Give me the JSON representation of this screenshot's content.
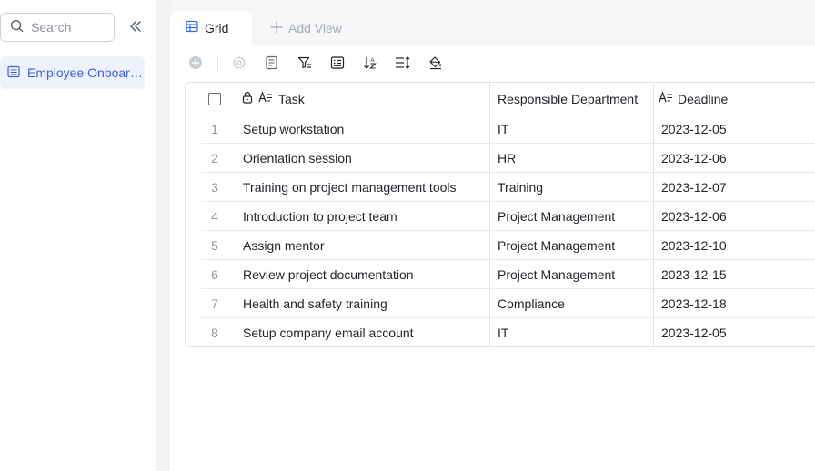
{
  "sidebar": {
    "search_placeholder": "Search",
    "collapse_icon": "double-chevron-left-icon",
    "table_item_label": "Employee Onboarding",
    "table_item_icon": "table-icon",
    "accent_color": "#3b63d9",
    "active_bg": "#eef2fd"
  },
  "tabs": {
    "active_label": "Grid",
    "add_view_label": "Add View"
  },
  "toolbar": {
    "icons": [
      "add-record-icon",
      "settings-icon",
      "field-icon",
      "filter-icon",
      "card-icon",
      "sort-icon",
      "row-height-icon",
      "paint-icon"
    ]
  },
  "grid": {
    "columns": {
      "task": "Task",
      "department": "Responsible Department",
      "deadline": "Deadline"
    },
    "rows": [
      {
        "num": "1",
        "task": "Setup workstation",
        "department": "IT",
        "deadline": "2023-12-05"
      },
      {
        "num": "2",
        "task": "Orientation session",
        "department": "HR",
        "deadline": "2023-12-06"
      },
      {
        "num": "3",
        "task": "Training on project management tools",
        "department": "Training",
        "deadline": "2023-12-07"
      },
      {
        "num": "4",
        "task": "Introduction to project team",
        "department": "Project Management",
        "deadline": "2023-12-06"
      },
      {
        "num": "5",
        "task": "Assign mentor",
        "department": "Project Management",
        "deadline": "2023-12-10"
      },
      {
        "num": "6",
        "task": "Review project documentation",
        "department": "Project Management",
        "deadline": "2023-12-15"
      },
      {
        "num": "7",
        "task": "Health and safety training",
        "department": "Compliance",
        "deadline": "2023-12-18"
      },
      {
        "num": "8",
        "task": "Setup company email account",
        "department": "IT",
        "deadline": "2023-12-05"
      }
    ]
  }
}
